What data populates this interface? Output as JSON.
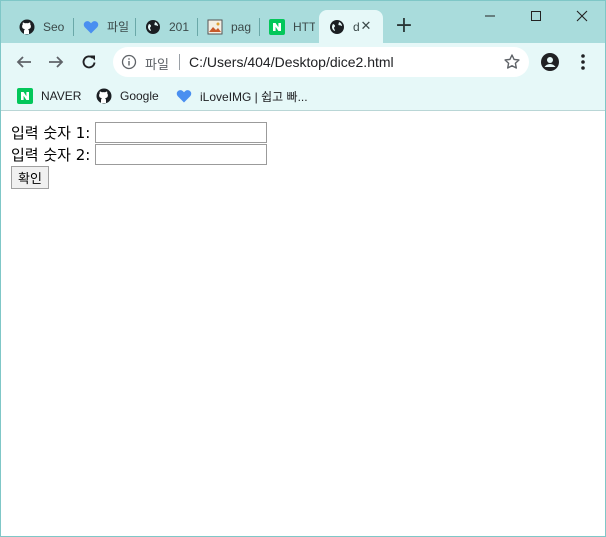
{
  "browser": {
    "tabs": [
      {
        "title": "Seo",
        "icon": "github-icon"
      },
      {
        "title": "파일",
        "icon": "heart-icon"
      },
      {
        "title": "201",
        "icon": "globe-icon"
      },
      {
        "title": "pag",
        "icon": "image-icon"
      },
      {
        "title": "HTT",
        "icon": "naver-icon"
      },
      {
        "title": "d",
        "icon": "globe-icon",
        "active": true
      }
    ],
    "new_tab_label": "+",
    "omnibox": {
      "scheme_label": "파일",
      "url": "C:/Users/404/Desktop/dice2.html"
    },
    "bookmarks": [
      {
        "label": "NAVER",
        "icon": "naver-icon"
      },
      {
        "label": "Google",
        "icon": "github-icon"
      },
      {
        "label": "iLoveIMG | 쉽고 빠...",
        "icon": "heart-icon"
      }
    ],
    "colors": {
      "frame": "#a9dcdc",
      "toolbar": "#e6f8f8",
      "naver_green": "#03c75a",
      "heart_blue": "#4a8ff0"
    }
  },
  "page": {
    "label1": "입력 숫자 1:",
    "label2": "입력 숫자 2:",
    "input1_value": "",
    "input2_value": "",
    "confirm_label": "확인"
  }
}
